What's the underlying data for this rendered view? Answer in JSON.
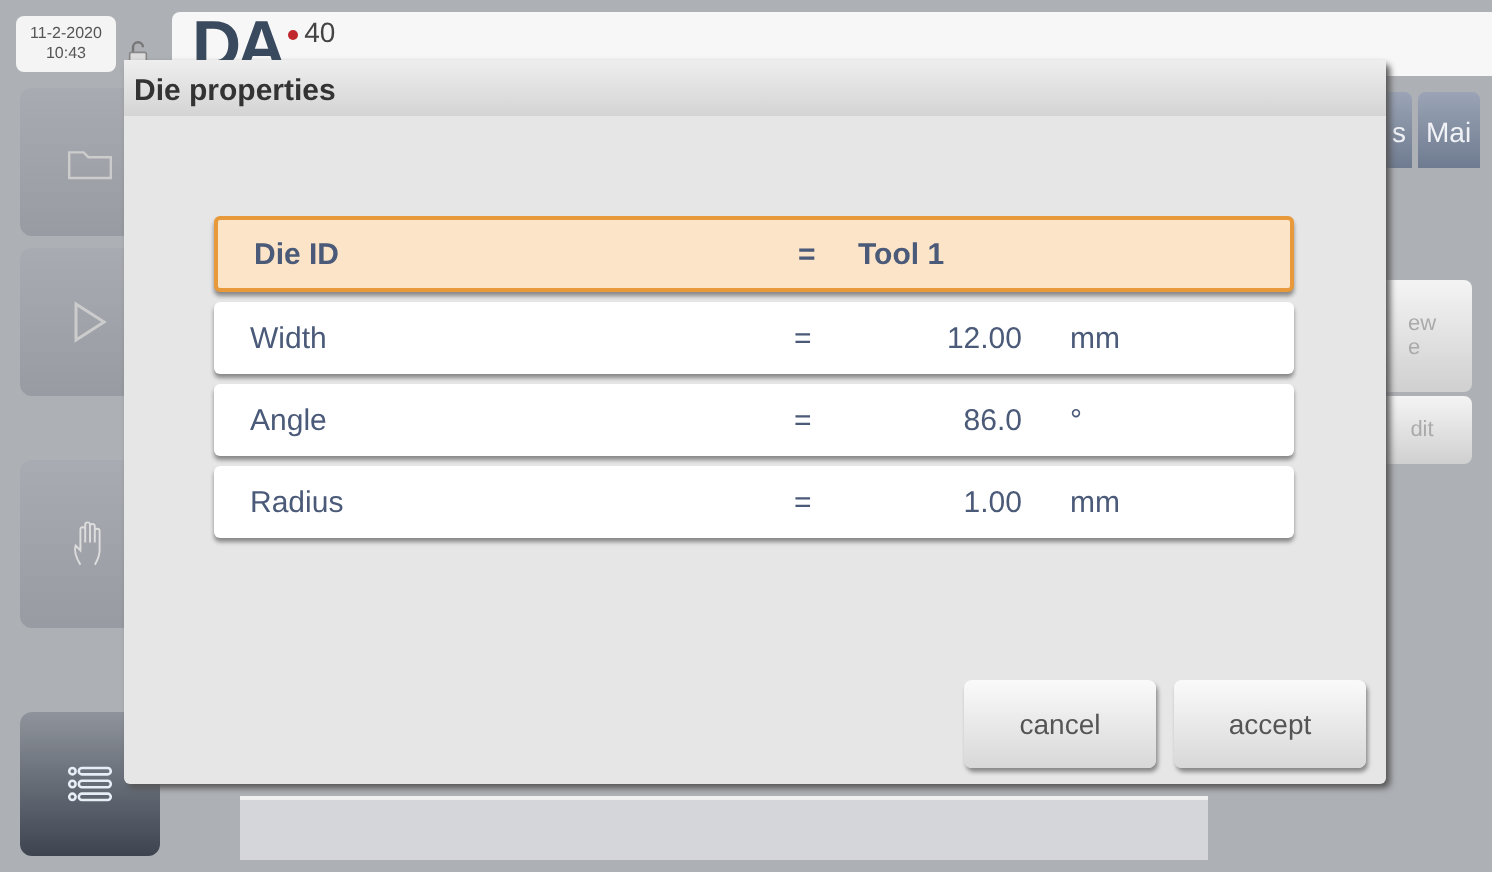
{
  "status": {
    "date": "11-2-2020",
    "time": "10:43"
  },
  "logo": {
    "letters": "DA",
    "model": "40"
  },
  "tabs": [
    {
      "label": "s",
      "selected": false
    },
    {
      "label": "Mai",
      "selected": false
    }
  ],
  "side_buttons": [
    {
      "label": "ew\ne"
    },
    {
      "label": "dit"
    }
  ],
  "dialog": {
    "title": "Die properties",
    "rows": [
      {
        "label": "Die ID",
        "value": "Tool 1",
        "unit": "",
        "selected": true
      },
      {
        "label": "Width",
        "value": "12.00",
        "unit": "mm",
        "selected": false
      },
      {
        "label": "Angle",
        "value": "86.0",
        "unit": "°",
        "selected": false
      },
      {
        "label": "Radius",
        "value": "1.00",
        "unit": "mm",
        "selected": false
      }
    ],
    "equals": "=",
    "buttons": [
      "cancel",
      "accept"
    ]
  }
}
